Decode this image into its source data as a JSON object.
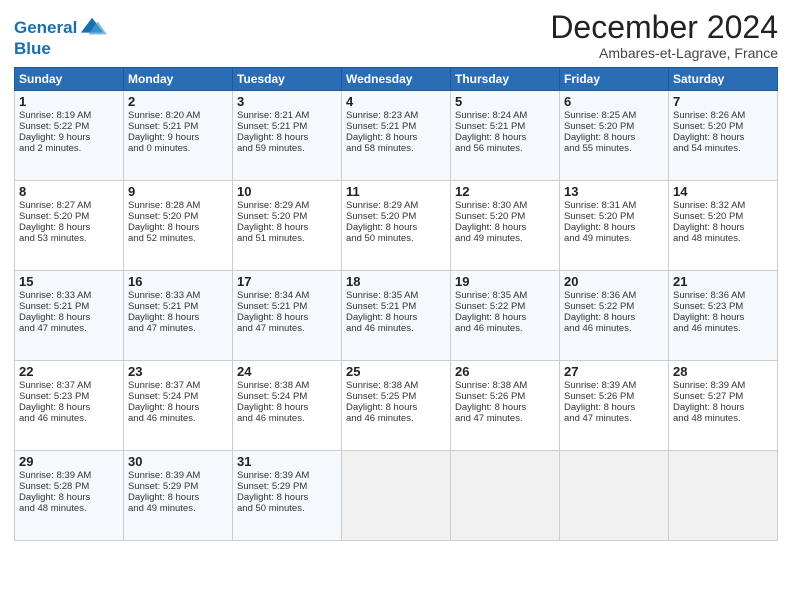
{
  "header": {
    "logo_line1": "General",
    "logo_line2": "Blue",
    "month": "December 2024",
    "location": "Ambares-et-Lagrave, France"
  },
  "days_of_week": [
    "Sunday",
    "Monday",
    "Tuesday",
    "Wednesday",
    "Thursday",
    "Friday",
    "Saturday"
  ],
  "weeks": [
    [
      {
        "day": 1,
        "lines": [
          "Sunrise: 8:19 AM",
          "Sunset: 5:22 PM",
          "Daylight: 9 hours",
          "and 2 minutes."
        ]
      },
      {
        "day": 2,
        "lines": [
          "Sunrise: 8:20 AM",
          "Sunset: 5:21 PM",
          "Daylight: 9 hours",
          "and 0 minutes."
        ]
      },
      {
        "day": 3,
        "lines": [
          "Sunrise: 8:21 AM",
          "Sunset: 5:21 PM",
          "Daylight: 8 hours",
          "and 59 minutes."
        ]
      },
      {
        "day": 4,
        "lines": [
          "Sunrise: 8:23 AM",
          "Sunset: 5:21 PM",
          "Daylight: 8 hours",
          "and 58 minutes."
        ]
      },
      {
        "day": 5,
        "lines": [
          "Sunrise: 8:24 AM",
          "Sunset: 5:21 PM",
          "Daylight: 8 hours",
          "and 56 minutes."
        ]
      },
      {
        "day": 6,
        "lines": [
          "Sunrise: 8:25 AM",
          "Sunset: 5:20 PM",
          "Daylight: 8 hours",
          "and 55 minutes."
        ]
      },
      {
        "day": 7,
        "lines": [
          "Sunrise: 8:26 AM",
          "Sunset: 5:20 PM",
          "Daylight: 8 hours",
          "and 54 minutes."
        ]
      }
    ],
    [
      {
        "day": 8,
        "lines": [
          "Sunrise: 8:27 AM",
          "Sunset: 5:20 PM",
          "Daylight: 8 hours",
          "and 53 minutes."
        ]
      },
      {
        "day": 9,
        "lines": [
          "Sunrise: 8:28 AM",
          "Sunset: 5:20 PM",
          "Daylight: 8 hours",
          "and 52 minutes."
        ]
      },
      {
        "day": 10,
        "lines": [
          "Sunrise: 8:29 AM",
          "Sunset: 5:20 PM",
          "Daylight: 8 hours",
          "and 51 minutes."
        ]
      },
      {
        "day": 11,
        "lines": [
          "Sunrise: 8:29 AM",
          "Sunset: 5:20 PM",
          "Daylight: 8 hours",
          "and 50 minutes."
        ]
      },
      {
        "day": 12,
        "lines": [
          "Sunrise: 8:30 AM",
          "Sunset: 5:20 PM",
          "Daylight: 8 hours",
          "and 49 minutes."
        ]
      },
      {
        "day": 13,
        "lines": [
          "Sunrise: 8:31 AM",
          "Sunset: 5:20 PM",
          "Daylight: 8 hours",
          "and 49 minutes."
        ]
      },
      {
        "day": 14,
        "lines": [
          "Sunrise: 8:32 AM",
          "Sunset: 5:20 PM",
          "Daylight: 8 hours",
          "and 48 minutes."
        ]
      }
    ],
    [
      {
        "day": 15,
        "lines": [
          "Sunrise: 8:33 AM",
          "Sunset: 5:21 PM",
          "Daylight: 8 hours",
          "and 47 minutes."
        ]
      },
      {
        "day": 16,
        "lines": [
          "Sunrise: 8:33 AM",
          "Sunset: 5:21 PM",
          "Daylight: 8 hours",
          "and 47 minutes."
        ]
      },
      {
        "day": 17,
        "lines": [
          "Sunrise: 8:34 AM",
          "Sunset: 5:21 PM",
          "Daylight: 8 hours",
          "and 47 minutes."
        ]
      },
      {
        "day": 18,
        "lines": [
          "Sunrise: 8:35 AM",
          "Sunset: 5:21 PM",
          "Daylight: 8 hours",
          "and 46 minutes."
        ]
      },
      {
        "day": 19,
        "lines": [
          "Sunrise: 8:35 AM",
          "Sunset: 5:22 PM",
          "Daylight: 8 hours",
          "and 46 minutes."
        ]
      },
      {
        "day": 20,
        "lines": [
          "Sunrise: 8:36 AM",
          "Sunset: 5:22 PM",
          "Daylight: 8 hours",
          "and 46 minutes."
        ]
      },
      {
        "day": 21,
        "lines": [
          "Sunrise: 8:36 AM",
          "Sunset: 5:23 PM",
          "Daylight: 8 hours",
          "and 46 minutes."
        ]
      }
    ],
    [
      {
        "day": 22,
        "lines": [
          "Sunrise: 8:37 AM",
          "Sunset: 5:23 PM",
          "Daylight: 8 hours",
          "and 46 minutes."
        ]
      },
      {
        "day": 23,
        "lines": [
          "Sunrise: 8:37 AM",
          "Sunset: 5:24 PM",
          "Daylight: 8 hours",
          "and 46 minutes."
        ]
      },
      {
        "day": 24,
        "lines": [
          "Sunrise: 8:38 AM",
          "Sunset: 5:24 PM",
          "Daylight: 8 hours",
          "and 46 minutes."
        ]
      },
      {
        "day": 25,
        "lines": [
          "Sunrise: 8:38 AM",
          "Sunset: 5:25 PM",
          "Daylight: 8 hours",
          "and 46 minutes."
        ]
      },
      {
        "day": 26,
        "lines": [
          "Sunrise: 8:38 AM",
          "Sunset: 5:26 PM",
          "Daylight: 8 hours",
          "and 47 minutes."
        ]
      },
      {
        "day": 27,
        "lines": [
          "Sunrise: 8:39 AM",
          "Sunset: 5:26 PM",
          "Daylight: 8 hours",
          "and 47 minutes."
        ]
      },
      {
        "day": 28,
        "lines": [
          "Sunrise: 8:39 AM",
          "Sunset: 5:27 PM",
          "Daylight: 8 hours",
          "and 48 minutes."
        ]
      }
    ],
    [
      {
        "day": 29,
        "lines": [
          "Sunrise: 8:39 AM",
          "Sunset: 5:28 PM",
          "Daylight: 8 hours",
          "and 48 minutes."
        ]
      },
      {
        "day": 30,
        "lines": [
          "Sunrise: 8:39 AM",
          "Sunset: 5:29 PM",
          "Daylight: 8 hours",
          "and 49 minutes."
        ]
      },
      {
        "day": 31,
        "lines": [
          "Sunrise: 8:39 AM",
          "Sunset: 5:29 PM",
          "Daylight: 8 hours",
          "and 50 minutes."
        ]
      },
      null,
      null,
      null,
      null
    ]
  ]
}
